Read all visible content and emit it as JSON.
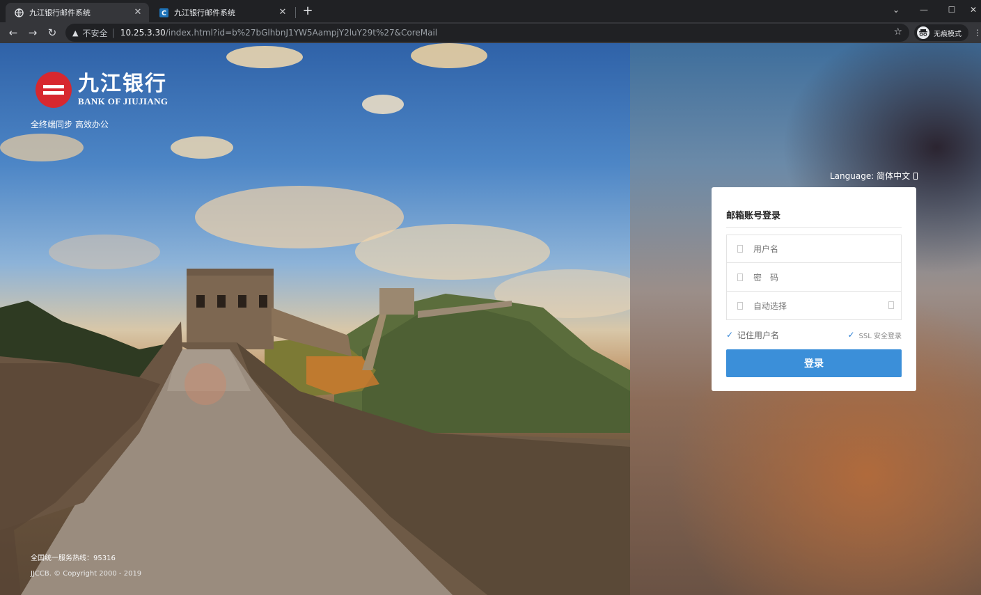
{
  "browser": {
    "tabs": [
      {
        "title": "九江银行邮件系统",
        "active": true,
        "favicon": "globe-icon"
      },
      {
        "title": "九江银行邮件系统",
        "active": false,
        "favicon": "coremail-c-icon"
      }
    ],
    "new_tab_symbol": "+",
    "window_controls": {
      "dropdown": "⌄",
      "minimize": "—",
      "maximize": "☐",
      "close": "✕"
    },
    "address": {
      "security_label": "不安全",
      "host": "10.25.3.30",
      "path": "/index.html?id=b%27bGlhbnJ1YW5AampjY2luY29t%27&CoreMail"
    },
    "incognito_label": "无痕模式"
  },
  "branding": {
    "name_cn": "九江银行",
    "name_en": "BANK OF JIUJIANG",
    "slogan": "全终端同步 高效办公",
    "brand_color": "#d7282f"
  },
  "footer": {
    "hotline": "全国统一服务热线：95316",
    "copyright": "JJCCB. © Copyright 2000 - 2019"
  },
  "language": {
    "label": "Language:",
    "current": "简体中文"
  },
  "login": {
    "title": "邮箱账号登录",
    "username_placeholder": "用户名",
    "password_placeholder": "密　码",
    "domain_select": "自动选择",
    "remember_label": "记住用户名",
    "remember_checked": true,
    "ssl_label": "SSL 安全登录",
    "ssl_checked": true,
    "submit_label": "登录",
    "accent_color": "#3b8fd9"
  }
}
